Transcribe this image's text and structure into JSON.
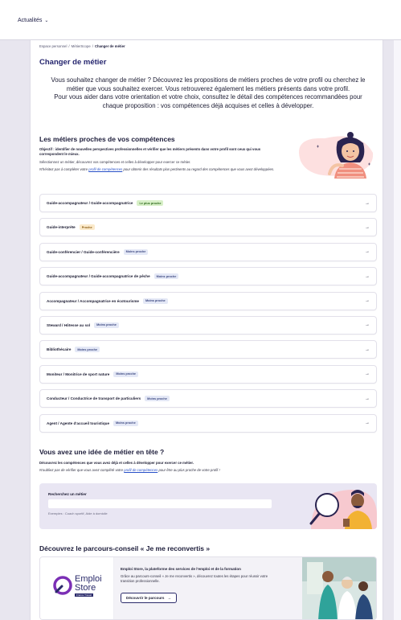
{
  "topbar": {
    "menu_label": "Actualités",
    "menu_icon": "chevron-down-icon"
  },
  "breadcrumb": {
    "items": [
      "Espace personnel",
      "MétierScope"
    ],
    "separator": "/",
    "current": "Changer de métier"
  },
  "page_title": "Changer de métier",
  "intro": {
    "line1": "Vous souhaitez changer de métier ? Découvrez les propositions de métiers proches de votre profil ou cherchez le",
    "line2": "métier que vous souhaitez exercer. Vous retrouverez également les métiers présents dans votre profil.",
    "line3": "Pour vous aider dans votre orientation et votre choix, consultez le détail des compétences recommandées pour",
    "line4": "chaque proposition : vos compétences déjà acquises et celles à développer."
  },
  "close_jobs": {
    "title": "Les métiers proches de vos compétences",
    "objective": "Objectif : identifier de nouvelles perspectives professionnelles et vérifier que les métiers présents dans votre profil sont ceux qui vous correspondent le mieux.",
    "select_hint": "Sélectionnez un métier, découvrez vos compétences et celles à développer pour exercer ce métier.",
    "tip_before": "N'hésitez pas à compléter votre ",
    "tip_link": "profil de compétences",
    "tip_after": " pour obtenir des résultats plus pertinents au regard des compétences que vous avez développées.",
    "items": [
      {
        "label": "Guide-accompagnateur / Guide-accompagnatrice",
        "badge": "Le plus proche",
        "level": "plus"
      },
      {
        "label": "Guide-interprète",
        "badge": "Proche",
        "level": "proche"
      },
      {
        "label": "Guide-conférencier / Guide-conférencière",
        "badge": "Moins proche",
        "level": "moins"
      },
      {
        "label": "Guide-accompagnateur / Guide-accompagnatrice de pêche",
        "badge": "Moins proche",
        "level": "moins"
      },
      {
        "label": "Accompagnateur / Accompagnatrice en écotourisme",
        "badge": "Moins proche",
        "level": "moins"
      },
      {
        "label": "Steward / Hôtesse au sol",
        "badge": "Moins proche",
        "level": "moins"
      },
      {
        "label": "Bibliothécaire",
        "badge": "Moins proche",
        "level": "moins"
      },
      {
        "label": "Moniteur / Monitrice de sport nature",
        "badge": "Moins proche",
        "level": "moins"
      },
      {
        "label": "Conducteur / Conductrice de transport de particuliers",
        "badge": "Moins proche",
        "level": "moins"
      },
      {
        "label": "Agent / Agente d'accueil touristique",
        "badge": "Moins proche",
        "level": "moins"
      }
    ],
    "arrow_icon": "arrow-right-icon"
  },
  "job_idea": {
    "title": "Vous avez une idée de métier en tête ?",
    "desc": "Découvrez les compétences que vous avez déjà et celles à développer pour exercer ce métier.",
    "tip_before": "N'oubliez pas de vérifier que vous avez complété votre ",
    "tip_link": "profil de compétences",
    "tip_after": " pour être au plus proche de votre profil !",
    "search_label": "Recherchez un métier",
    "search_value": "",
    "search_placeholder": "",
    "examples": "Exemples : Coach sportif, Aide à domicile"
  },
  "reconversion": {
    "title": "Découvrez le parcours-conseil « Je me reconvertis »",
    "logo_line1": "Emploi",
    "logo_line2": "Store",
    "logo_tag": "France Travail",
    "card_title": "Emploi Store, la plateforme des services de l'emploi et de la formation",
    "card_desc": "Grâce au parcours-conseil « Je me reconvertis », découvrez toutes les étapes pour réussir votre transition professionnelle.",
    "button_label": "Découvrir le parcours",
    "button_icon": "arrow-right-icon"
  },
  "colors": {
    "title": "#25256e",
    "badge_plus": "#d8f0c8",
    "badge_proche": "#fbeacb",
    "badge_moins": "#e4e8f6",
    "search_bg": "#e9e6f3",
    "page_bg": "#e8e6ef"
  }
}
